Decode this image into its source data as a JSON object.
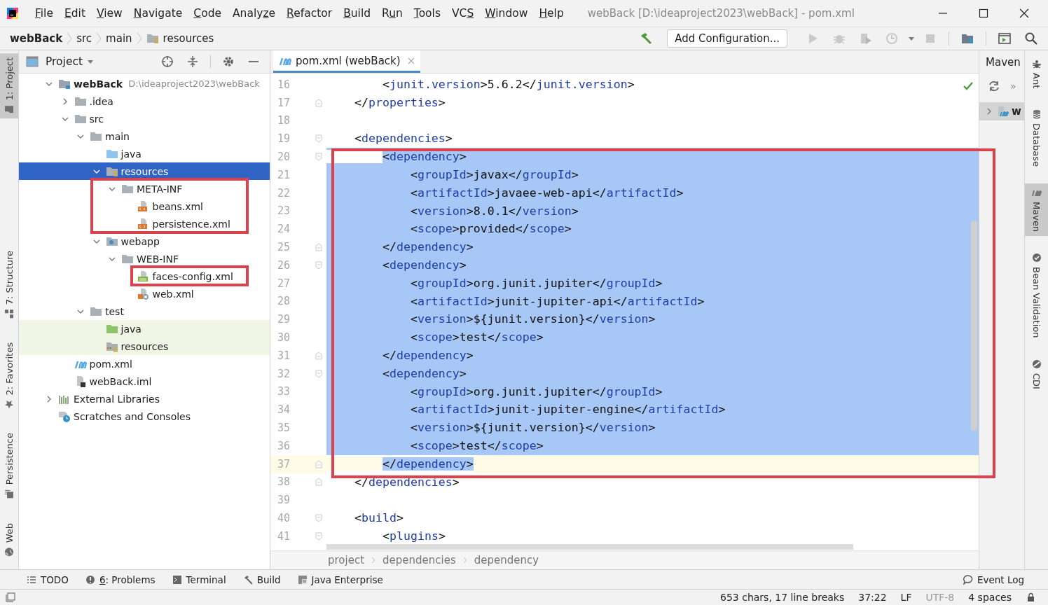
{
  "window": {
    "title": "webBack [D:\\ideaproject2023\\webBack] - pom.xml"
  },
  "menu": [
    {
      "key": "F",
      "post": "ile"
    },
    {
      "key": "E",
      "post": "dit"
    },
    {
      "key": "V",
      "post": "iew"
    },
    {
      "key": "N",
      "post": "avigate"
    },
    {
      "key": "C",
      "post": "ode"
    },
    {
      "pre": "Analy",
      "key": "z",
      "post": "e"
    },
    {
      "key": "R",
      "post": "efactor"
    },
    {
      "key": "B",
      "post": "uild"
    },
    {
      "pre": "R",
      "key": "u",
      "post": "n"
    },
    {
      "key": "T",
      "post": "ools"
    },
    {
      "pre": "VC",
      "key": "S"
    },
    {
      "key": "W",
      "post": "indow"
    },
    {
      "key": "H",
      "post": "elp"
    }
  ],
  "navigation": {
    "crumbs": [
      {
        "label": "webBack",
        "kind": "project"
      },
      {
        "label": "src",
        "kind": "plain"
      },
      {
        "label": "main",
        "kind": "plain"
      },
      {
        "label": "resources",
        "kind": "folder"
      }
    ],
    "run_config": "Add Configuration..."
  },
  "left_strip": [
    {
      "label": "1: Project",
      "kind": "project",
      "selected": true
    },
    {
      "label": "7: Structure",
      "kind": "structure",
      "selected": false
    },
    {
      "label": "2: Favorites",
      "kind": "favorites",
      "selected": false
    },
    {
      "label": "Persistence",
      "kind": "persistence",
      "selected": false
    },
    {
      "label": "Web",
      "kind": "web",
      "selected": false
    }
  ],
  "project_panel": {
    "title": "Project",
    "tree": [
      {
        "label": "webBack",
        "path": "D:\\ideaproject2023\\webBack",
        "kind": "module",
        "expanded": true,
        "selected": false,
        "annotated": false,
        "children": [
          {
            "label": ".idea",
            "kind": "folder",
            "expanded": false,
            "selected": false,
            "annotated": false
          },
          {
            "label": "src",
            "kind": "folder",
            "expanded": true,
            "selected": false,
            "annotated": false,
            "children": [
              {
                "label": "main",
                "kind": "folder",
                "expanded": true,
                "selected": false,
                "annotated": false,
                "children": [
                  {
                    "label": "java",
                    "kind": "source-folder",
                    "selected": false,
                    "annotated": false
                  },
                  {
                    "label": "resources",
                    "kind": "resources-folder",
                    "expanded": true,
                    "selected": true,
                    "annotated": false,
                    "children": [
                      {
                        "label": "META-INF",
                        "kind": "folder",
                        "expanded": true,
                        "selected": false,
                        "annotated": true,
                        "children": [
                          {
                            "label": "beans.xml",
                            "kind": "xml-file",
                            "selected": false,
                            "annotated": true
                          },
                          {
                            "label": "persistence.xml",
                            "kind": "xml-file",
                            "selected": false,
                            "annotated": true
                          }
                        ]
                      }
                    ]
                  },
                  {
                    "label": "webapp",
                    "kind": "web-folder",
                    "expanded": true,
                    "selected": false,
                    "annotated": false,
                    "children": [
                      {
                        "label": "WEB-INF",
                        "kind": "folder",
                        "expanded": true,
                        "selected": false,
                        "annotated": false,
                        "children": [
                          {
                            "label": "faces-config.xml",
                            "kind": "jsf-file",
                            "selected": false,
                            "annotated": true
                          },
                          {
                            "label": "web.xml",
                            "kind": "web-xml-file",
                            "selected": false,
                            "annotated": false
                          }
                        ]
                      }
                    ]
                  }
                ]
              },
              {
                "label": "test",
                "kind": "folder",
                "expanded": true,
                "selected": false,
                "annotated": false,
                "children": [
                  {
                    "label": "java",
                    "kind": "test-source-folder",
                    "selected": false,
                    "annotated": false
                  },
                  {
                    "label": "resources",
                    "kind": "test-resources-folder",
                    "selected": false,
                    "annotated": false
                  }
                ]
              }
            ]
          },
          {
            "label": "pom.xml",
            "kind": "maven-file",
            "selected": false,
            "annotated": false
          },
          {
            "label": "webBack.iml",
            "kind": "iml-file",
            "selected": false,
            "annotated": false
          }
        ]
      },
      {
        "label": "External Libraries",
        "kind": "libraries",
        "expanded": false,
        "selected": false,
        "annotated": false
      },
      {
        "label": "Scratches and Consoles",
        "kind": "scratches",
        "selected": false,
        "annotated": false
      }
    ]
  },
  "editor": {
    "tab": {
      "label": "pom.xml (webBack)",
      "selected": true
    },
    "lines": [
      {
        "number": "16",
        "text": "        <junit.version>5.6.2</junit.version>",
        "kind": "plain",
        "selected": false,
        "current": false,
        "annotated": false
      },
      {
        "number": "17",
        "text": "    </properties>",
        "kind": "fold-end",
        "selected": false,
        "current": false,
        "annotated": false
      },
      {
        "number": "18",
        "kind": "plain",
        "current": false
      },
      {
        "number": "19",
        "text": "    <dependencies>",
        "kind": "fold-start",
        "selected": false,
        "current": false,
        "annotated": false
      },
      {
        "number": "20",
        "text": "        <dependency>",
        "kind": "fold-start",
        "selected": true,
        "current": false,
        "annotated": true
      },
      {
        "number": "21",
        "text": "            <groupId>javax</groupId>",
        "kind": "plain",
        "selected": true,
        "current": false,
        "annotated": true
      },
      {
        "number": "22",
        "text": "            <artifactId>javaee-web-api</artifactId>",
        "kind": "plain",
        "selected": true,
        "current": false,
        "annotated": true
      },
      {
        "number": "23",
        "text": "            <version>8.0.1</version>",
        "kind": "plain",
        "selected": true,
        "current": false,
        "annotated": true
      },
      {
        "number": "24",
        "text": "            <scope>provided</scope>",
        "kind": "plain",
        "selected": true,
        "current": false,
        "annotated": true
      },
      {
        "number": "25",
        "text": "        </dependency>",
        "kind": "fold-end",
        "selected": true,
        "current": false,
        "annotated": true
      },
      {
        "number": "26",
        "text": "        <dependency>",
        "kind": "fold-start",
        "selected": true,
        "current": false,
        "annotated": true
      },
      {
        "number": "27",
        "text": "            <groupId>org.junit.jupiter</groupId>",
        "kind": "plain",
        "selected": true,
        "current": false,
        "annotated": true
      },
      {
        "number": "28",
        "text": "            <artifactId>junit-jupiter-api</artifactId>",
        "kind": "plain",
        "selected": true,
        "current": false,
        "annotated": true
      },
      {
        "number": "29",
        "text": "            <version>${junit.version}</version>",
        "kind": "plain",
        "selected": true,
        "current": false,
        "annotated": true
      },
      {
        "number": "30",
        "text": "            <scope>test</scope>",
        "kind": "plain",
        "selected": true,
        "current": false,
        "annotated": true
      },
      {
        "number": "31",
        "text": "        </dependency>",
        "kind": "fold-end",
        "selected": true,
        "current": false,
        "annotated": true
      },
      {
        "number": "32",
        "text": "        <dependency>",
        "kind": "fold-start",
        "selected": true,
        "current": false,
        "annotated": true
      },
      {
        "number": "33",
        "text": "            <groupId>org.junit.jupiter</groupId>",
        "kind": "plain",
        "selected": true,
        "current": false,
        "annotated": true
      },
      {
        "number": "34",
        "text": "            <artifactId>junit-jupiter-engine</artifactId>",
        "kind": "plain",
        "selected": true,
        "current": false,
        "annotated": true
      },
      {
        "number": "35",
        "text": "            <version>${junit.version}</version>",
        "kind": "plain",
        "selected": true,
        "current": false,
        "annotated": true
      },
      {
        "number": "36",
        "text": "            <scope>test</scope>",
        "kind": "plain",
        "selected": true,
        "current": false,
        "annotated": true
      },
      {
        "number": "37",
        "text": "        </dependency>",
        "kind": "fold-end",
        "selected": true,
        "current": true,
        "annotated": true
      },
      {
        "number": "38",
        "text": "    </dependencies>",
        "kind": "fold-end",
        "selected": false,
        "current": false,
        "annotated": false
      },
      {
        "number": "39",
        "kind": "plain",
        "current": false
      },
      {
        "number": "40",
        "text": "    <build>",
        "kind": "fold-start",
        "selected": false,
        "current": false,
        "annotated": false
      },
      {
        "number": "41",
        "text": "        <plugins>",
        "kind": "fold-start",
        "selected": false,
        "current": false,
        "annotated": false
      }
    ],
    "breadcrumbs": [
      "project",
      "dependencies",
      "dependency"
    ]
  },
  "maven_panel": {
    "title": "Maven",
    "more": "»",
    "row_label": "w"
  },
  "right_strip": [
    {
      "label": "Ant",
      "kind": "ant",
      "selected": false
    },
    {
      "label": "Database",
      "kind": "database",
      "selected": false
    },
    {
      "label": "Maven",
      "kind": "maven",
      "selected": true
    },
    {
      "label": "Bean Validation",
      "kind": "bean-validation",
      "selected": false
    },
    {
      "label": "CDI",
      "kind": "cdi",
      "selected": false
    }
  ],
  "bottom_tools": [
    {
      "text": "TODO",
      "kind": "todo"
    },
    {
      "key": "6",
      "text": ": Problems",
      "kind": "problems"
    },
    {
      "text": "Terminal",
      "kind": "terminal"
    },
    {
      "text": "Build",
      "kind": "build"
    },
    {
      "text": "Java Enterprise",
      "kind": "java-enterprise"
    }
  ],
  "event_log": "Event Log",
  "status_bar": [
    {
      "text": "653 chars, 17 line breaks",
      "kind": "plain"
    },
    {
      "text": "37:22",
      "kind": "plain"
    },
    {
      "text": "LF",
      "kind": "plain"
    },
    {
      "text": "UTF-8",
      "kind": "dim"
    },
    {
      "text": "4 spaces",
      "kind": "plain"
    }
  ]
}
